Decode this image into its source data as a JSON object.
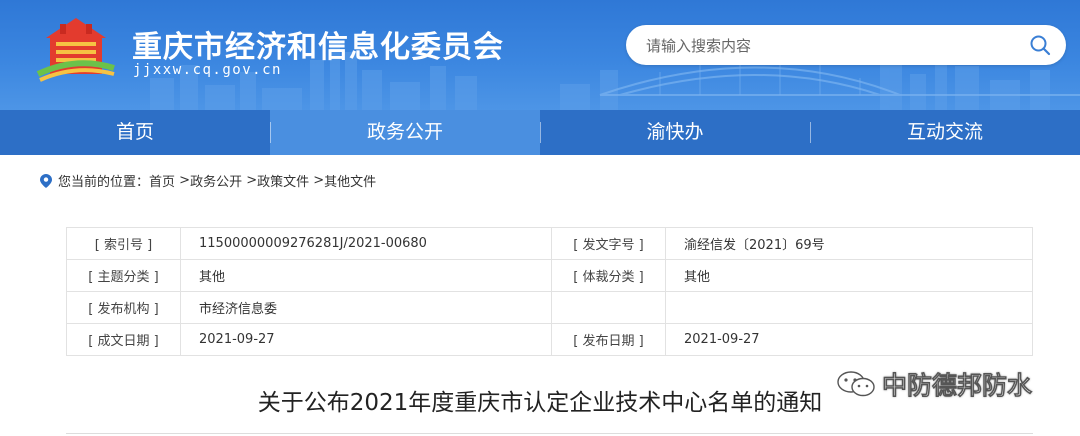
{
  "site": {
    "title": "重庆市经济和信息化委员会",
    "domain": "jjxxw.cq.gov.cn",
    "search_placeholder": "请输入搜索内容"
  },
  "nav": {
    "items": [
      {
        "label": "首页"
      },
      {
        "label": "政务公开",
        "active": true
      },
      {
        "label": "渝快办"
      },
      {
        "label": "互动交流"
      }
    ]
  },
  "breadcrumb": {
    "prefix": "您当前的位置：",
    "items": [
      "首页",
      "政务公开",
      "政策文件",
      "其他文件"
    ],
    "separator": " >"
  },
  "meta": {
    "index_no_label": "[ 索引号 ]",
    "index_no": "11500000009276281J/2021-00680",
    "doc_no_label": "[ 发文字号 ]",
    "doc_no": "渝经信发〔2021〕69号",
    "topic_label": "[ 主题分类 ]",
    "topic": "其他",
    "genre_label": "[ 体裁分类 ]",
    "genre": "其他",
    "issuer_label": "[ 发布机构 ]",
    "issuer": "市经济信息委",
    "created_label": "[ 成文日期 ]",
    "created": "2021-09-27",
    "published_label": "[ 发布日期 ]",
    "published": "2021-09-27"
  },
  "article": {
    "title": "关于公布2021年度重庆市认定企业技术中心名单的通知"
  },
  "watermark": {
    "text": "中防德邦防水"
  },
  "colors": {
    "banner": "#3b86e0",
    "nav": "#2d6fc6",
    "nav_active": "#4a8fe0"
  }
}
